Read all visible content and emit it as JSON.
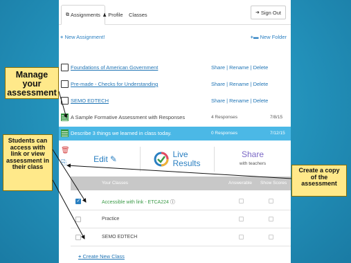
{
  "tabs": {
    "assignments": "Assignments",
    "profile": "Profile",
    "classes": "Classes",
    "sign_out": "Sign Out"
  },
  "toolbar": {
    "new_assignment": "New Assignment!",
    "new_folder": "New Folder"
  },
  "folders": [
    {
      "name": "Foundations of American Government",
      "actions": "Share | Rename | Delete"
    },
    {
      "name": "Pre-made - Checks for Understanding",
      "actions": "Share | Rename | Delete"
    },
    {
      "name": "SEMO EDTECH",
      "actions": "Share | Rename | Delete"
    }
  ],
  "assignments": [
    {
      "name": "A Sample Formative Assessment with Responses",
      "responses": "4 Responses",
      "date": "7/8/15",
      "selected": false
    },
    {
      "name": "Describe 3 things we learned in class today.",
      "responses": "0 Responses",
      "date": "7/12/15",
      "selected": true
    }
  ],
  "panel": {
    "edit": "Edit",
    "live": "Live",
    "results": "Results",
    "share": "Share",
    "share_sub": "with teachers"
  },
  "classes_table": {
    "col_classes": "Your Classes",
    "col_answerable": "Answerable",
    "col_show_scores": "Show Scores",
    "rows": [
      {
        "name": "Accessible with link - ETCA224",
        "checked": true
      },
      {
        "name": "Practice",
        "checked": false
      },
      {
        "name": "SEMO EDTECH",
        "checked": false
      }
    ],
    "create_new": "Create New Class"
  },
  "callouts": {
    "manage": "Manage your assessment",
    "students": "Students can access with link or view assessment in their class",
    "copy": "Create a copy of the assessment"
  },
  "colors": {
    "background": "#2596be",
    "accent_blue": "#2a7fc1",
    "selected_row": "#4bb8e6",
    "callout": "#ffe98a",
    "green": "#3a9a46",
    "share_purple": "#7b68c6"
  }
}
